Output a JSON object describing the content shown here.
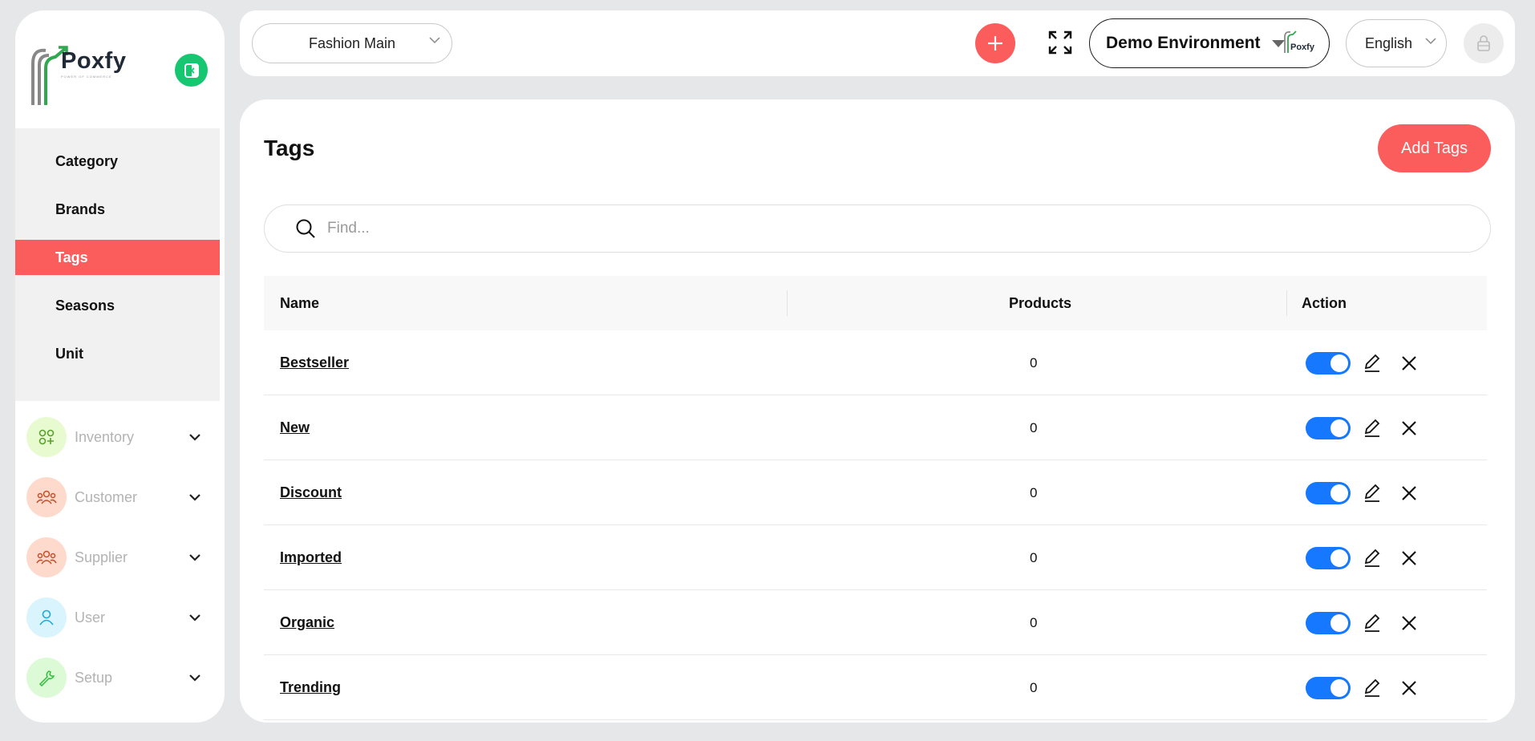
{
  "brand": {
    "name": "Poxfy",
    "tagline": "POWER OF COMMERCE",
    "accent": "#fb5c5c"
  },
  "sidebar": {
    "submenu": [
      {
        "label": "Category",
        "active": false
      },
      {
        "label": "Brands",
        "active": false
      },
      {
        "label": "Tags",
        "active": true
      },
      {
        "label": "Seasons",
        "active": false
      },
      {
        "label": "Unit",
        "active": false
      }
    ],
    "nav": [
      {
        "label": "Inventory",
        "icon": "inventory-icon",
        "color": "#e8fbd0"
      },
      {
        "label": "Customer",
        "icon": "customer-icon",
        "color": "#fddacc"
      },
      {
        "label": "Supplier",
        "icon": "supplier-icon",
        "color": "#fddacc"
      },
      {
        "label": "User",
        "icon": "user-icon",
        "color": "#d9f4fc"
      },
      {
        "label": "Setup",
        "icon": "setup-icon",
        "color": "#dcfad6"
      }
    ]
  },
  "topbar": {
    "store": "Fashion Main",
    "environment": "Demo Environment",
    "env_logo_text": "Poxfy",
    "language": "English"
  },
  "main": {
    "title": "Tags",
    "add_button": "Add Tags",
    "search_placeholder": "Find...",
    "columns": {
      "name": "Name",
      "products": "Products",
      "action": "Action"
    },
    "rows": [
      {
        "name": "Bestseller",
        "products": "0",
        "enabled": true
      },
      {
        "name": "New",
        "products": "0",
        "enabled": true
      },
      {
        "name": "Discount",
        "products": "0",
        "enabled": true
      },
      {
        "name": "Imported",
        "products": "0",
        "enabled": true
      },
      {
        "name": "Organic",
        "products": "0",
        "enabled": true
      },
      {
        "name": "Trending",
        "products": "0",
        "enabled": true
      }
    ]
  }
}
